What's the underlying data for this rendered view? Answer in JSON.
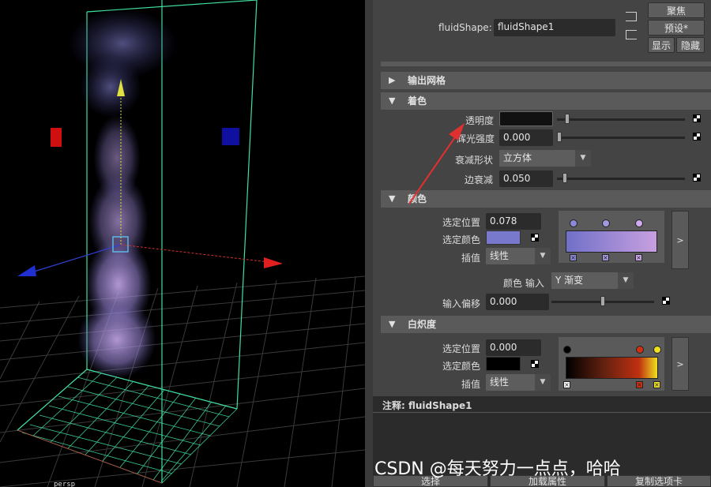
{
  "viewport": {
    "axis_label": "persp"
  },
  "header": {
    "shape_label": "fluidShape:",
    "shape_value": "fluidShape1",
    "btn_focus": "聚焦",
    "btn_preset": "预设*",
    "btn_show": "显示",
    "btn_hide": "隐藏"
  },
  "sections": {
    "output_mesh": "输出网格",
    "shading": "着色",
    "color": "颜色",
    "incandescence": "白炽度"
  },
  "shading": {
    "transparency_label": "透明度",
    "glow_label": "辉光强度",
    "glow_value": "0.000",
    "dropoff_shape_label": "衰减形状",
    "dropoff_shape_value": "立方体",
    "edge_dropoff_label": "边衰减",
    "edge_dropoff_value": "0.050"
  },
  "color_ramp": {
    "selected_position_label": "选定位置",
    "selected_position_value": "0.078",
    "selected_color_label": "选定颜色",
    "selected_color": "#7878cc",
    "interpolation_label": "插值",
    "interpolation_value": "线性",
    "color_input_label": "颜色 输入",
    "color_input_value": "Y 渐变",
    "input_bias_label": "输入偏移",
    "input_bias_value": "0.000",
    "expand_glyph": ">"
  },
  "incandescence_ramp": {
    "selected_position_label": "选定位置",
    "selected_position_value": "0.000",
    "selected_color_label": "选定颜色",
    "selected_color": "#000000",
    "interpolation_label": "插值",
    "interpolation_value": "线性",
    "expand_glyph": ">"
  },
  "notes": {
    "label": "注释: fluidShape1"
  },
  "bottom_buttons": [
    "选择",
    "加载属性",
    "复制选项卡"
  ],
  "watermark": "CSDN @每天努力一点点，哈哈",
  "colors": {
    "annotation_arrow": "#e03030",
    "bounding_box": "#40e0a0",
    "grid_selected": "#40e0a0"
  }
}
